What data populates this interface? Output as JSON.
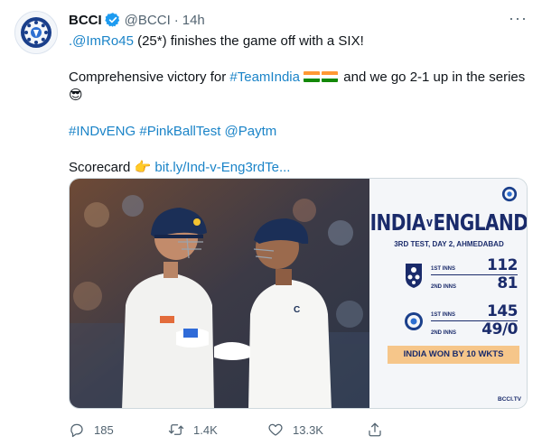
{
  "tweet": {
    "author": {
      "display_name": "BCCI",
      "handle": "@BCCI",
      "separator": "·",
      "time": "14h",
      "avatar_icon": "bcci-crest-icon",
      "verified_icon": "verified-badge-icon"
    },
    "more_label": "···",
    "text": {
      "line1_mention": ".@ImRo45",
      "line1_rest": " (25*) finishes the game off with a SIX!",
      "line2_start": "Comprehensive victory for ",
      "line2_hashtag": "#TeamIndia",
      "line2_end": " and we go 2-1 up in the series",
      "line2_emoji": "😎",
      "line3_hashtags": "#INDvENG #PinkBallTest @Paytm",
      "line4_label": "Scorecard ",
      "line4_emoji": "👉",
      "line4_link": "bit.ly/Ind-v-Eng3rdTe..."
    },
    "media": {
      "photo_description_icon": "cricket-players-photo",
      "card": {
        "title_left": "INDIA",
        "title_mid": "v",
        "title_right": "ENGLAND",
        "subtitle": "3RD TEST, DAY 2, AHMEDABAD",
        "england": {
          "first_label": "1ST INNS",
          "first_score": "112",
          "second_label": "2ND INNS",
          "second_score": "81"
        },
        "india": {
          "first_label": "1ST INNS",
          "first_score": "145",
          "second_label": "2ND INNS",
          "second_score": "49/0"
        },
        "result": "INDIA WON BY 10 WKTS",
        "watermark": "BCCI.TV"
      }
    },
    "actions": {
      "reply_count": "185",
      "retweet_count": "1.4K",
      "like_count": "13.3K"
    },
    "colors": {
      "link": "#1b84c8",
      "muted": "#536471",
      "verified": "#1d9bf0",
      "card_navy": "#1a2b6b",
      "result_bg": "#f6c68a"
    }
  }
}
